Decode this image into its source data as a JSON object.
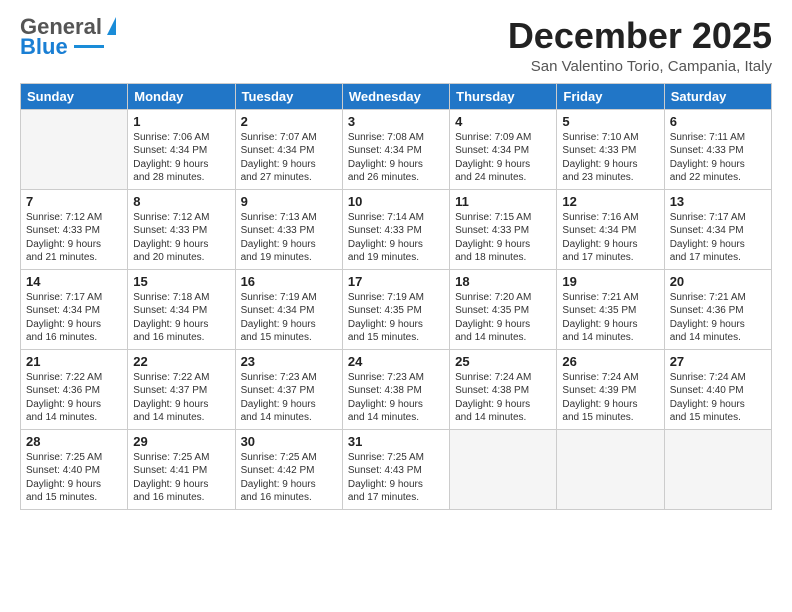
{
  "logo": {
    "line1": "General",
    "line2": "Blue"
  },
  "title": "December 2025",
  "location": "San Valentino Torio, Campania, Italy",
  "days_of_week": [
    "Sunday",
    "Monday",
    "Tuesday",
    "Wednesday",
    "Thursday",
    "Friday",
    "Saturday"
  ],
  "weeks": [
    [
      {
        "day": "",
        "info": ""
      },
      {
        "day": "1",
        "info": "Sunrise: 7:06 AM\nSunset: 4:34 PM\nDaylight: 9 hours\nand 28 minutes."
      },
      {
        "day": "2",
        "info": "Sunrise: 7:07 AM\nSunset: 4:34 PM\nDaylight: 9 hours\nand 27 minutes."
      },
      {
        "day": "3",
        "info": "Sunrise: 7:08 AM\nSunset: 4:34 PM\nDaylight: 9 hours\nand 26 minutes."
      },
      {
        "day": "4",
        "info": "Sunrise: 7:09 AM\nSunset: 4:34 PM\nDaylight: 9 hours\nand 24 minutes."
      },
      {
        "day": "5",
        "info": "Sunrise: 7:10 AM\nSunset: 4:33 PM\nDaylight: 9 hours\nand 23 minutes."
      },
      {
        "day": "6",
        "info": "Sunrise: 7:11 AM\nSunset: 4:33 PM\nDaylight: 9 hours\nand 22 minutes."
      }
    ],
    [
      {
        "day": "7",
        "info": "Sunrise: 7:12 AM\nSunset: 4:33 PM\nDaylight: 9 hours\nand 21 minutes."
      },
      {
        "day": "8",
        "info": "Sunrise: 7:12 AM\nSunset: 4:33 PM\nDaylight: 9 hours\nand 20 minutes."
      },
      {
        "day": "9",
        "info": "Sunrise: 7:13 AM\nSunset: 4:33 PM\nDaylight: 9 hours\nand 19 minutes."
      },
      {
        "day": "10",
        "info": "Sunrise: 7:14 AM\nSunset: 4:33 PM\nDaylight: 9 hours\nand 19 minutes."
      },
      {
        "day": "11",
        "info": "Sunrise: 7:15 AM\nSunset: 4:33 PM\nDaylight: 9 hours\nand 18 minutes."
      },
      {
        "day": "12",
        "info": "Sunrise: 7:16 AM\nSunset: 4:34 PM\nDaylight: 9 hours\nand 17 minutes."
      },
      {
        "day": "13",
        "info": "Sunrise: 7:17 AM\nSunset: 4:34 PM\nDaylight: 9 hours\nand 17 minutes."
      }
    ],
    [
      {
        "day": "14",
        "info": "Sunrise: 7:17 AM\nSunset: 4:34 PM\nDaylight: 9 hours\nand 16 minutes."
      },
      {
        "day": "15",
        "info": "Sunrise: 7:18 AM\nSunset: 4:34 PM\nDaylight: 9 hours\nand 16 minutes."
      },
      {
        "day": "16",
        "info": "Sunrise: 7:19 AM\nSunset: 4:34 PM\nDaylight: 9 hours\nand 15 minutes."
      },
      {
        "day": "17",
        "info": "Sunrise: 7:19 AM\nSunset: 4:35 PM\nDaylight: 9 hours\nand 15 minutes."
      },
      {
        "day": "18",
        "info": "Sunrise: 7:20 AM\nSunset: 4:35 PM\nDaylight: 9 hours\nand 14 minutes."
      },
      {
        "day": "19",
        "info": "Sunrise: 7:21 AM\nSunset: 4:35 PM\nDaylight: 9 hours\nand 14 minutes."
      },
      {
        "day": "20",
        "info": "Sunrise: 7:21 AM\nSunset: 4:36 PM\nDaylight: 9 hours\nand 14 minutes."
      }
    ],
    [
      {
        "day": "21",
        "info": "Sunrise: 7:22 AM\nSunset: 4:36 PM\nDaylight: 9 hours\nand 14 minutes."
      },
      {
        "day": "22",
        "info": "Sunrise: 7:22 AM\nSunset: 4:37 PM\nDaylight: 9 hours\nand 14 minutes."
      },
      {
        "day": "23",
        "info": "Sunrise: 7:23 AM\nSunset: 4:37 PM\nDaylight: 9 hours\nand 14 minutes."
      },
      {
        "day": "24",
        "info": "Sunrise: 7:23 AM\nSunset: 4:38 PM\nDaylight: 9 hours\nand 14 minutes."
      },
      {
        "day": "25",
        "info": "Sunrise: 7:24 AM\nSunset: 4:38 PM\nDaylight: 9 hours\nand 14 minutes."
      },
      {
        "day": "26",
        "info": "Sunrise: 7:24 AM\nSunset: 4:39 PM\nDaylight: 9 hours\nand 15 minutes."
      },
      {
        "day": "27",
        "info": "Sunrise: 7:24 AM\nSunset: 4:40 PM\nDaylight: 9 hours\nand 15 minutes."
      }
    ],
    [
      {
        "day": "28",
        "info": "Sunrise: 7:25 AM\nSunset: 4:40 PM\nDaylight: 9 hours\nand 15 minutes."
      },
      {
        "day": "29",
        "info": "Sunrise: 7:25 AM\nSunset: 4:41 PM\nDaylight: 9 hours\nand 16 minutes."
      },
      {
        "day": "30",
        "info": "Sunrise: 7:25 AM\nSunset: 4:42 PM\nDaylight: 9 hours\nand 16 minutes."
      },
      {
        "day": "31",
        "info": "Sunrise: 7:25 AM\nSunset: 4:43 PM\nDaylight: 9 hours\nand 17 minutes."
      },
      {
        "day": "",
        "info": ""
      },
      {
        "day": "",
        "info": ""
      },
      {
        "day": "",
        "info": ""
      }
    ]
  ]
}
